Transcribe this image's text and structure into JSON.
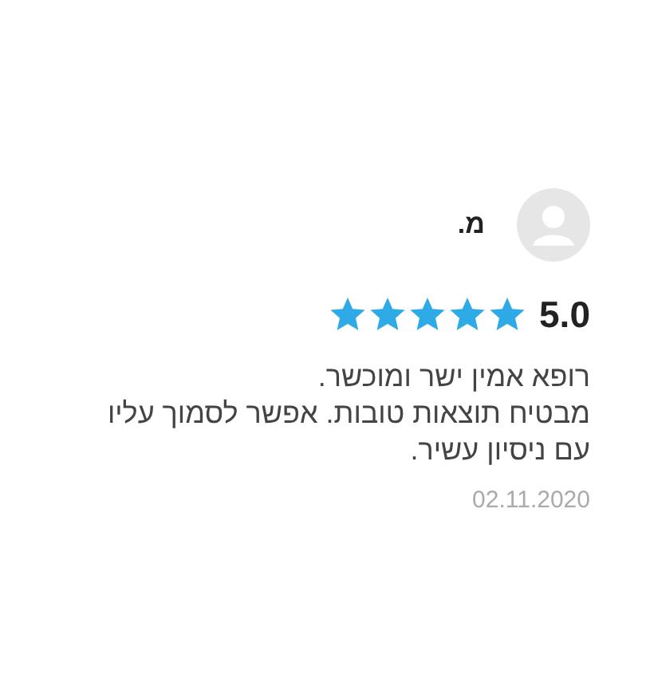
{
  "review": {
    "author": "מ.",
    "rating": "5.0",
    "stars": 5,
    "text": "רופא אמין ישר ומוכשר.\nמבטיח תוצאות טובות. אפשר לסמוך עליו עם ניסיון עשיר.",
    "date": "02.11.2020"
  }
}
